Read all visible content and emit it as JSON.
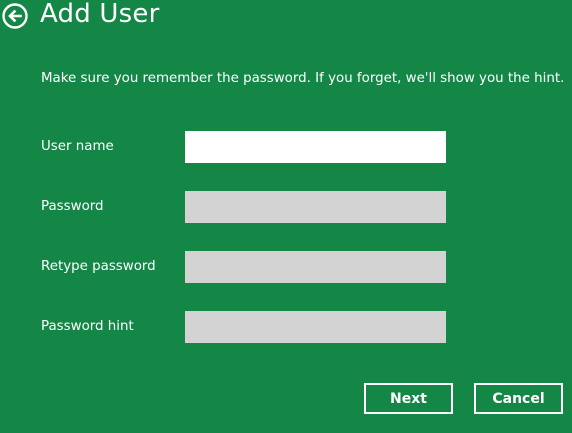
{
  "header": {
    "title": "Add User",
    "back_icon": "back-arrow-circle-icon"
  },
  "instruction": "Make sure you remember the password. If you forget, we'll show you the hint.",
  "fields": [
    {
      "label": "User name",
      "value": ""
    },
    {
      "label": "Password",
      "value": ""
    },
    {
      "label": "Retype password",
      "value": ""
    },
    {
      "label": "Password hint",
      "value": ""
    }
  ],
  "buttons": {
    "next_label": "Next",
    "cancel_label": "Cancel"
  },
  "colors": {
    "background": "#148747",
    "active_field": "#ffffff",
    "inactive_field": "#d3d3d3",
    "text": "#ffffff"
  }
}
